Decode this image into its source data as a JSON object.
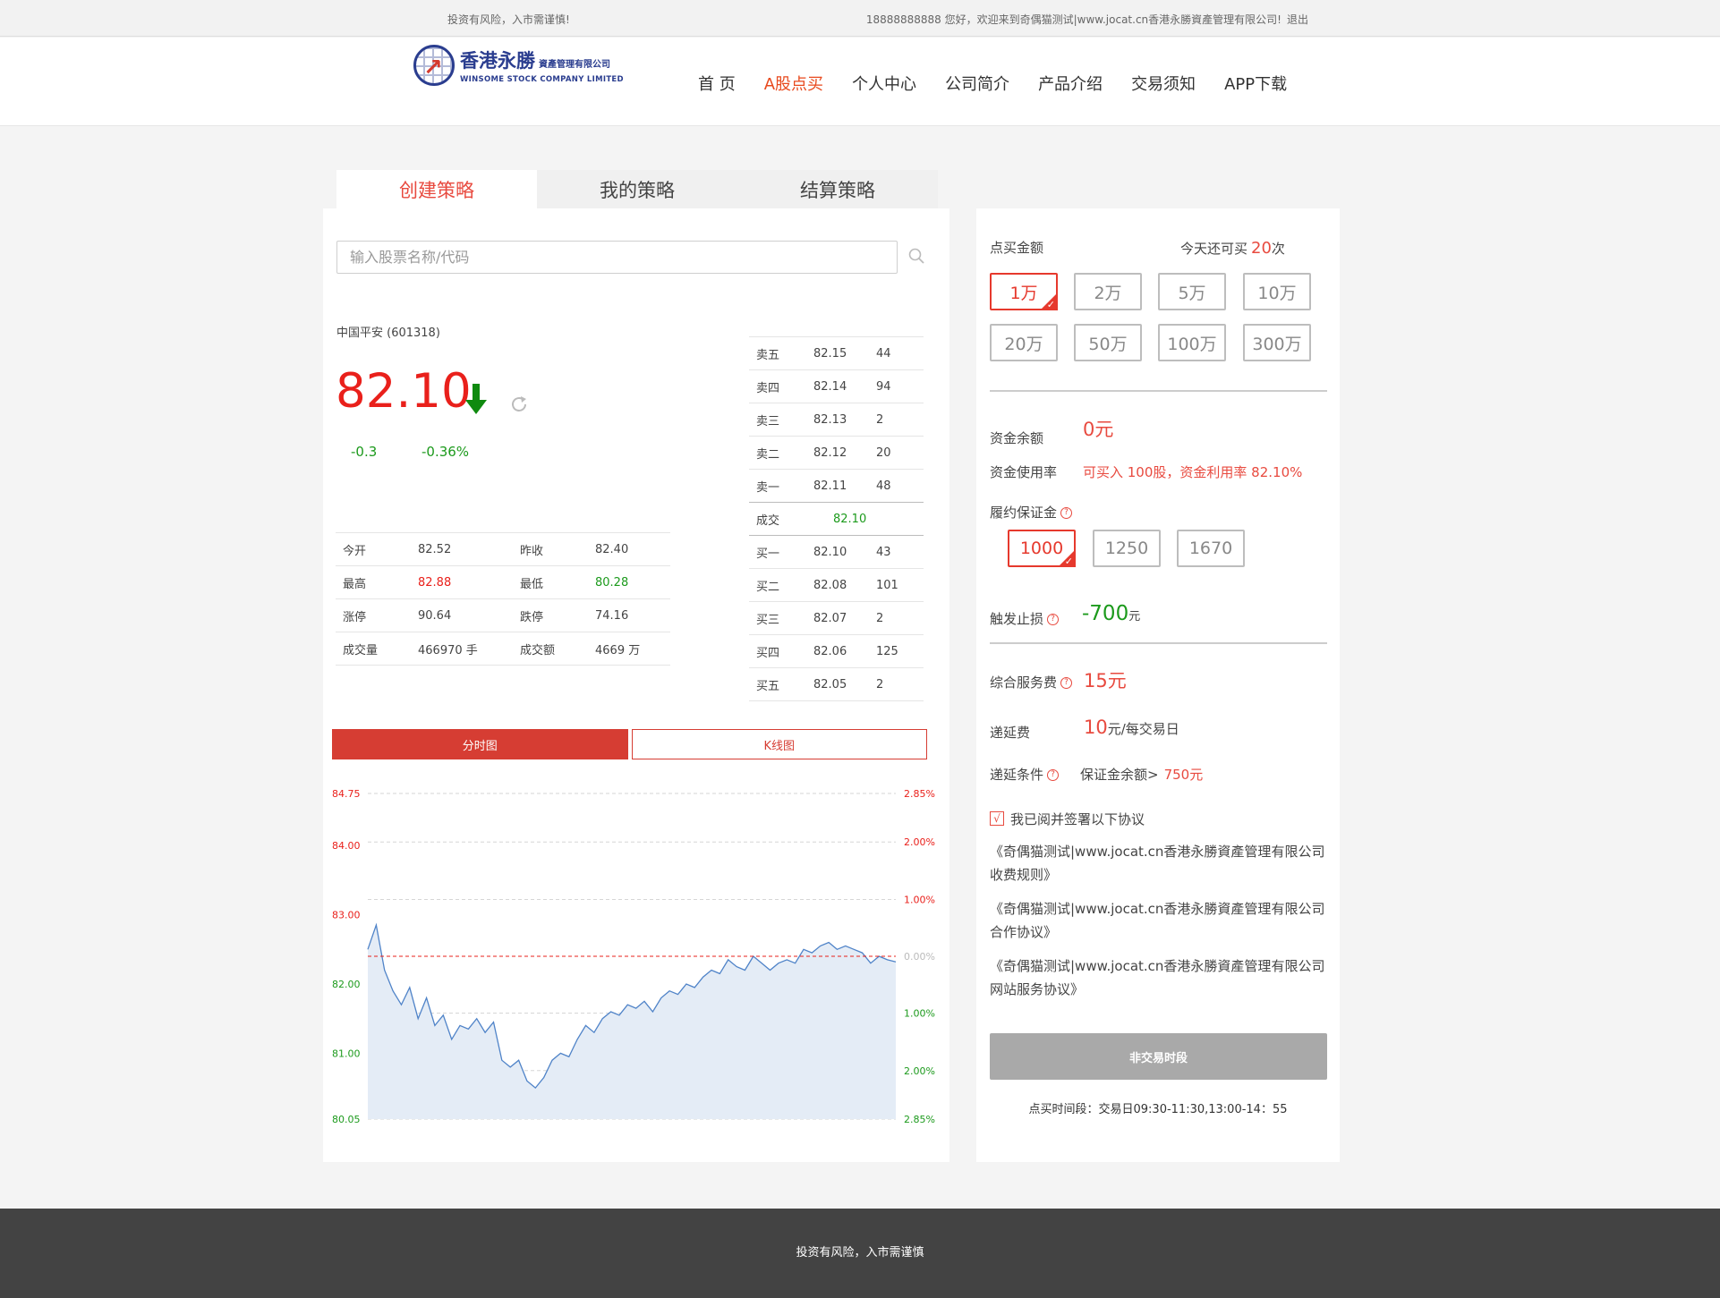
{
  "topbar": {
    "risk_text": "投资有风险，入市需谨慎!",
    "welcome_text": "18888888888 您好，欢迎来到奇偶猫测试|www.jocat.cn香港永勝資產管理有限公司!",
    "logout_label": "退出"
  },
  "logo": {
    "name_cn": "香港永勝",
    "name_cn_small": "資產管理有限公司",
    "name_en": "WINSOME STOCK COMPANY LIMITED"
  },
  "nav": {
    "items": [
      "首 页",
      "A股点买",
      "个人中心",
      "公司简介",
      "产品介绍",
      "交易须知",
      "APP下载"
    ],
    "active_index": 1
  },
  "tabs": [
    "创建策略",
    "我的策略",
    "结算策略"
  ],
  "search": {
    "placeholder": "输入股票名称/代码"
  },
  "stock": {
    "name": "中国平安 (601318)",
    "price": "82.10",
    "change": "-0.3",
    "change_pct": "-0.36%"
  },
  "quote": {
    "rows": [
      [
        "今开",
        "82.52",
        "昨收",
        "82.40"
      ],
      [
        "最高",
        "82.88",
        "最低",
        "80.28"
      ],
      [
        "涨停",
        "90.64",
        "跌停",
        "74.16"
      ],
      [
        "成交量",
        "466970 手",
        "成交额",
        "4669 万"
      ]
    ]
  },
  "order_book": {
    "sell": [
      [
        "卖五",
        "82.15",
        "44"
      ],
      [
        "卖四",
        "82.14",
        "94"
      ],
      [
        "卖三",
        "82.13",
        "2"
      ],
      [
        "卖二",
        "82.12",
        "20"
      ],
      [
        "卖一",
        "82.11",
        "48"
      ]
    ],
    "deal": [
      "成交",
      "82.10"
    ],
    "buy": [
      [
        "买一",
        "82.10",
        "43"
      ],
      [
        "买二",
        "82.08",
        "101"
      ],
      [
        "买三",
        "82.07",
        "2"
      ],
      [
        "买四",
        "82.06",
        "125"
      ],
      [
        "买五",
        "82.05",
        "2"
      ]
    ]
  },
  "chart_tabs": [
    "分时图",
    "K线图"
  ],
  "chart_data": {
    "type": "area",
    "ylim": [
      80.05,
      84.75
    ],
    "y_ticks_left": [
      "84.75",
      "84.00",
      "83.00",
      "82.00",
      "81.00",
      "80.05"
    ],
    "y_ticks_left_values": [
      84.75,
      84.0,
      83.0,
      82.0,
      81.0,
      80.05
    ],
    "y_ticks_right": [
      "2.85%",
      "2.00%",
      "1.00%",
      "0.00%",
      "1.00%",
      "2.00%",
      "2.85%"
    ],
    "y_ticks_right_values": [
      84.75,
      84.05,
      83.22,
      82.4,
      81.58,
      80.75,
      80.05
    ],
    "reference_price": 82.4,
    "values": [
      82.5,
      82.85,
      82.2,
      81.9,
      81.7,
      81.95,
      81.5,
      81.8,
      81.4,
      81.55,
      81.2,
      81.4,
      81.35,
      81.5,
      81.3,
      81.45,
      80.9,
      80.8,
      80.9,
      80.6,
      80.5,
      80.65,
      80.9,
      81.0,
      80.95,
      81.2,
      81.4,
      81.3,
      81.5,
      81.6,
      81.55,
      81.7,
      81.65,
      81.75,
      81.6,
      81.8,
      81.9,
      81.85,
      82.0,
      81.95,
      82.1,
      82.2,
      82.15,
      82.35,
      82.25,
      82.2,
      82.4,
      82.3,
      82.2,
      82.3,
      82.35,
      82.3,
      82.5,
      82.45,
      82.55,
      82.6,
      82.5,
      82.55,
      82.5,
      82.45,
      82.3,
      82.4,
      82.35,
      82.32
    ]
  },
  "right": {
    "amount_label": "点买金额",
    "remaining_prefix": "今天还可买",
    "remaining_count": "20",
    "remaining_suffix": "次",
    "amounts": [
      "1万",
      "2万",
      "5万",
      "10万",
      "20万",
      "50万",
      "100万",
      "300万"
    ],
    "balance_label": "资金余额",
    "balance_value": "0元",
    "usage_label": "资金使用率",
    "usage_value": "可买入 100股，资金利用率 82.10%",
    "margin_label": "履约保证金",
    "margins": [
      "1000",
      "1250",
      "1670"
    ],
    "stoploss_label": "触发止损",
    "stoploss_value": "-700",
    "stoploss_unit": "元",
    "service_label": "综合服务费",
    "service_value": "15元",
    "defer_label": "递延费",
    "defer_value": "10",
    "defer_unit": "元/每交易日",
    "defer_cond_label": "递延条件",
    "defer_cond_text": "保证金余额>",
    "defer_cond_value": "750元",
    "help_glyph": "?",
    "agree_check": "√",
    "agree_text": "我已阅并签署以下协议",
    "agreements": [
      "《奇偶猫测试|www.jocat.cn香港永勝資產管理有限公司收费规则》",
      "《奇偶猫测试|www.jocat.cn香港永勝資產管理有限公司合作协议》",
      "《奇偶猫测试|www.jocat.cn香港永勝資產管理有限公司网站服务协议》"
    ],
    "submit_label": "非交易时段",
    "trade_time": "点买时间段：交易日09:30-11:30,13:00-14：55"
  },
  "footer": {
    "text": "投资有风险，入市需谨慎"
  },
  "colors": {
    "accent": "#e84a3f",
    "up": "#e9201b",
    "down": "#1c9a1c",
    "chart_line": "#4f83c8",
    "chart_fill": "#e4ecf6",
    "footer_bg": "#434343"
  }
}
